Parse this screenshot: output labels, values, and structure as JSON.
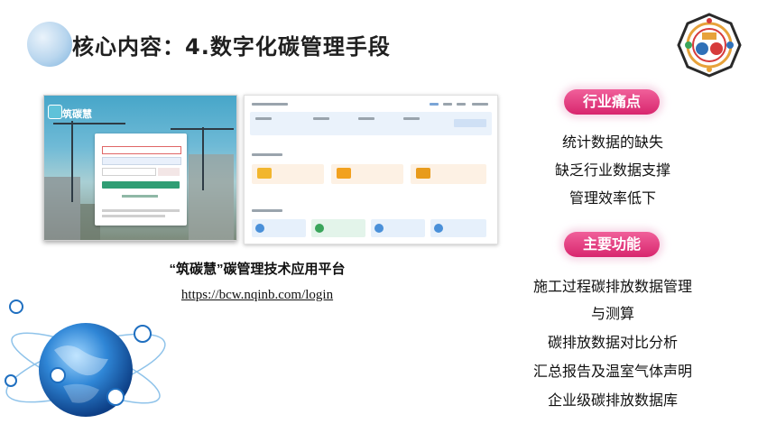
{
  "header": {
    "title": "核心内容：4.数字化碳管理手段"
  },
  "platform": {
    "login_app_name": "筑碳慧",
    "caption": "“筑碳慧”碳管理技术应用平台",
    "url": "https://bcw.nqinb.com/login"
  },
  "panel": {
    "pain_points_title": "行业痛点",
    "pain_points": [
      "统计数据的缺失",
      "缺乏行业数据支撑",
      "管理效率低下"
    ],
    "functions_title": "主要功能",
    "functions": [
      "施工过程碳排放数据管理",
      "与测算",
      "碳排放数据对比分析",
      "汇总报告及温室气体声明",
      "企业级碳排放数据库"
    ]
  },
  "colors": {
    "badge_pink": "#e03a7f",
    "title_dark": "#1f1f1f",
    "globe_blue": "#1f6fc0"
  }
}
